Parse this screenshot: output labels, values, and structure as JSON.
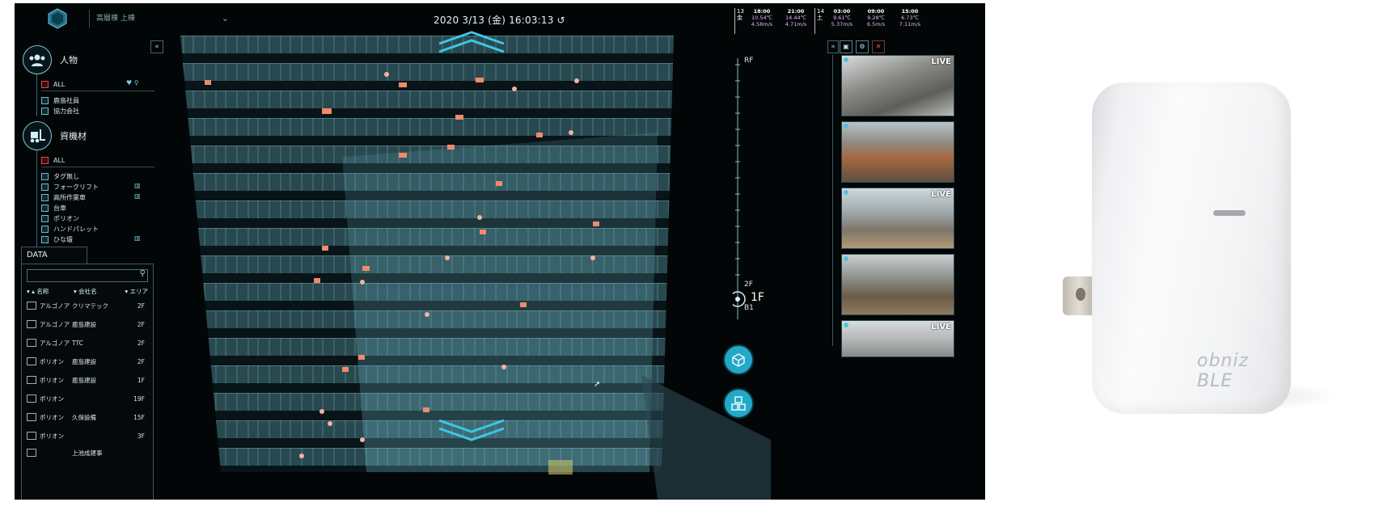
{
  "topbar": {
    "project": "高層棟 上棟",
    "datetime": "2020 3/13 (金) 16:03:13"
  },
  "weather": [
    {
      "day": "13 金",
      "slots": [
        {
          "time": "18:00",
          "temp": "10.54℃",
          "wind": "4.58m/s"
        },
        {
          "time": "21:00",
          "temp": "14.44℃",
          "wind": "4.71m/s"
        }
      ]
    },
    {
      "day": "14 土",
      "slots": [
        {
          "time": "03:00",
          "temp": "9.61℃",
          "wind": "5.37m/s"
        },
        {
          "time": "09:00",
          "temp": "9.28℃",
          "wind": "6.5m/s"
        },
        {
          "time": "15:00",
          "temp": "6.73℃",
          "wind": "7.11m/s"
        }
      ]
    }
  ],
  "left_panel": {
    "people": {
      "label": "人物",
      "all": "ALL",
      "items": [
        "鹿島社員",
        "協力会社"
      ]
    },
    "equipment": {
      "label": "資機材",
      "all": "ALL",
      "items": [
        "タグ無し",
        "フォークリフト",
        "高所作業車",
        "台車",
        "ポリオン",
        "ハンドパレット",
        "ひな壇"
      ]
    }
  },
  "data_panel": {
    "tab": "DATA",
    "columns": [
      "名称",
      "会社名",
      "エリア"
    ],
    "rows": [
      {
        "name": "アルゴノア",
        "company": "クリマテック",
        "area": "2F"
      },
      {
        "name": "アルゴノア",
        "company": "鹿島建設",
        "area": "2F"
      },
      {
        "name": "アルゴノア",
        "company": "TTC",
        "area": "2F"
      },
      {
        "name": "ポリオン",
        "company": "鹿島建設",
        "area": "2F"
      },
      {
        "name": "ポリオン",
        "company": "鹿島建設",
        "area": "1F"
      },
      {
        "name": "ポリオン",
        "company": "",
        "area": "19F"
      },
      {
        "name": "ポリオン",
        "company": "久保設備",
        "area": "15F"
      },
      {
        "name": "ポリオン",
        "company": "",
        "area": "3F"
      },
      {
        "name": "",
        "company": "上池成建事",
        "area": ""
      }
    ]
  },
  "floor_scale": {
    "top": "RF",
    "upper": "2F",
    "current": "1F",
    "lower": "B1"
  },
  "cameras": [
    {
      "live": "LIVE"
    },
    {
      "live": ""
    },
    {
      "live": "LIVE"
    },
    {
      "live": ""
    },
    {
      "live": "LIVE"
    }
  ],
  "device": {
    "brand": "obniz BLE"
  }
}
